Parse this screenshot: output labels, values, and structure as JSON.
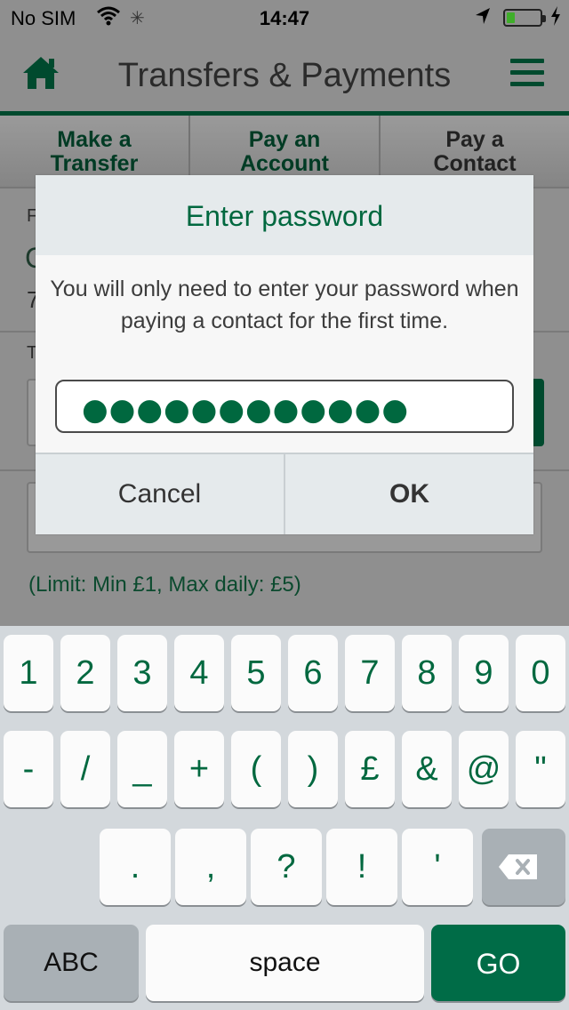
{
  "status_bar": {
    "carrier": "No SIM",
    "time": "14:47",
    "battery_percent": 25
  },
  "header": {
    "title": "Transfers & Payments"
  },
  "tabs": [
    {
      "line1": "Make a",
      "line2": "Transfer"
    },
    {
      "line1": "Pay an",
      "line2": "Account"
    },
    {
      "line1": "Pay a",
      "line2": "Contact"
    }
  ],
  "background": {
    "frag1": "F",
    "frag2": "C",
    "frag3": "7",
    "frag4": "T",
    "limit_text": "(Limit: Min £1, Max daily: £5)"
  },
  "dialog": {
    "title": "Enter password",
    "message": "You will only need to enter your password when paying a contact for the first time.",
    "password_mask": "●●●●●●●●●●●●",
    "cancel_label": "Cancel",
    "ok_label": "OK"
  },
  "keyboard": {
    "row1": [
      "1",
      "2",
      "3",
      "4",
      "5",
      "6",
      "7",
      "8",
      "9",
      "0"
    ],
    "row2": [
      "-",
      "/",
      "_",
      "+",
      "(",
      ")",
      "£",
      "&",
      "@",
      "\""
    ],
    "row3": [
      ".",
      ",",
      "?",
      "!",
      "'"
    ],
    "abc_label": "ABC",
    "space_label": "space",
    "go_label": "GO"
  },
  "colors": {
    "brand_green": "#00683f",
    "dark_green": "#004a2e"
  }
}
